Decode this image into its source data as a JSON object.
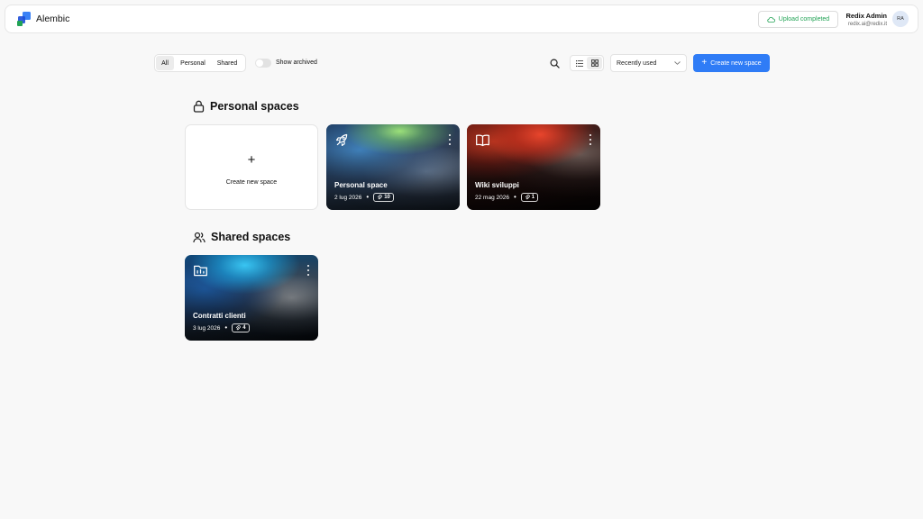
{
  "header": {
    "app_name": "Alembic",
    "upload_status": "Upload completed",
    "user_name": "Redix Admin",
    "user_email": "redix.ai@redix.it",
    "avatar_initials": "RA"
  },
  "filters": {
    "tabs": [
      "All",
      "Personal",
      "Shared"
    ],
    "active_tab": "All",
    "show_archived_label": "Show archived",
    "show_archived": false
  },
  "toolbar": {
    "sort_value": "Recently used",
    "create_label": "Create new space",
    "view_mode": "grid"
  },
  "personal": {
    "heading": "Personal spaces",
    "new_space_label": "Create new space",
    "cards": [
      {
        "title": "Personal space",
        "date": "2 lug 2026",
        "count": "10",
        "icon": "rocket-icon"
      },
      {
        "title": "Wiki sviluppi",
        "date": "22 mag 2026",
        "count": "1",
        "icon": "book-icon"
      }
    ]
  },
  "shared": {
    "heading": "Shared spaces",
    "cards": [
      {
        "title": "Contratti clienti",
        "date": "3 lug 2026",
        "count": "4",
        "icon": "folder-chart-icon"
      }
    ]
  },
  "colors": {
    "accent": "#2f7cf6",
    "success": "#22a355",
    "background": "#f8f8f8"
  }
}
